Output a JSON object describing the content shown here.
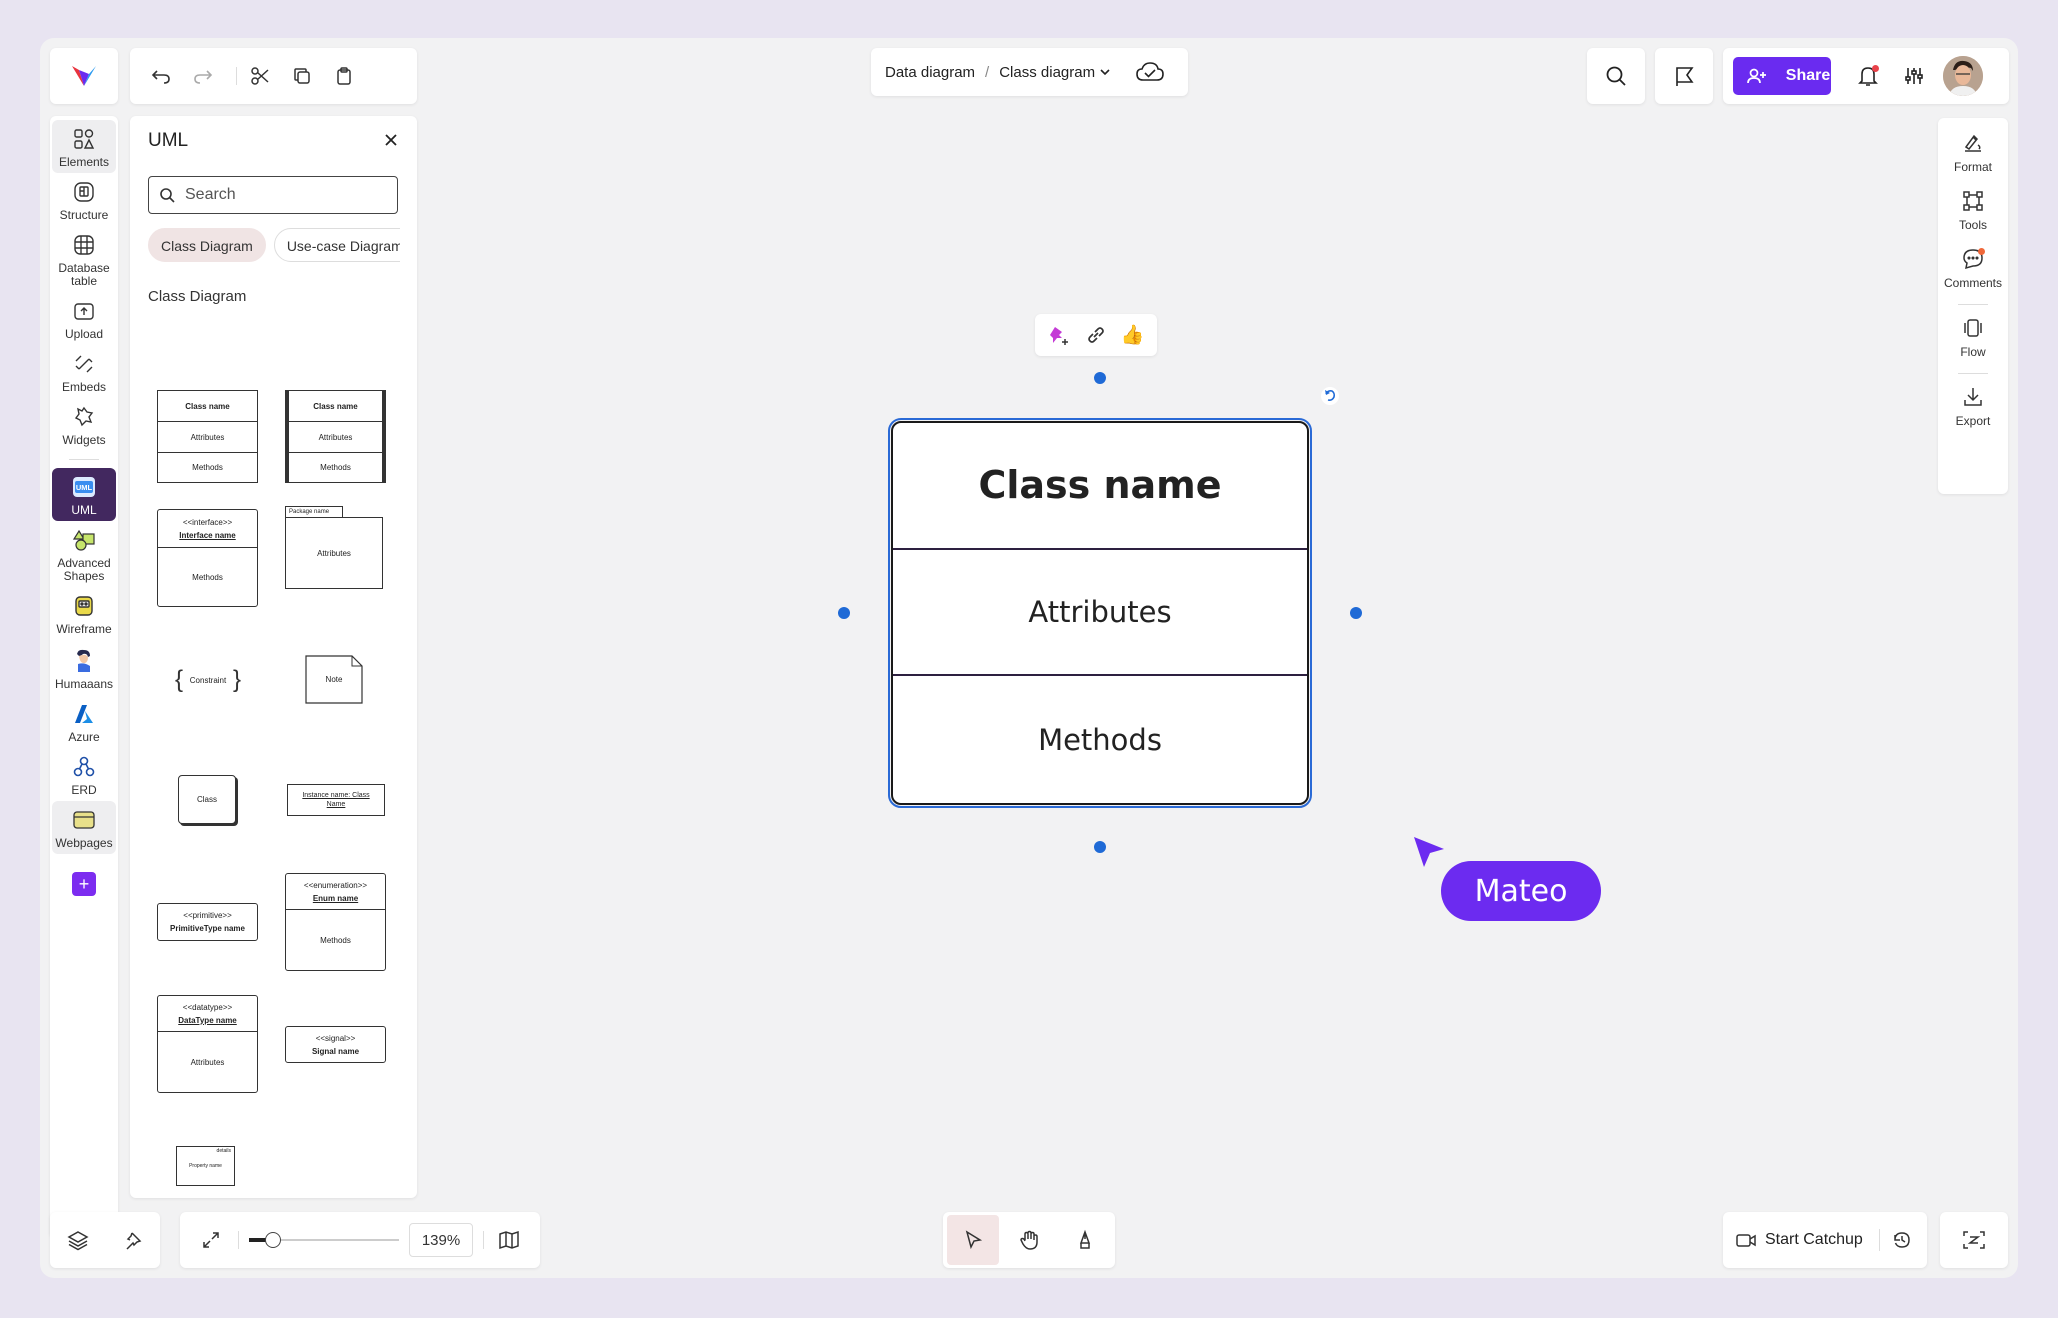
{
  "colors": {
    "accent": "#6a2bf0",
    "selection": "#1f6ad6",
    "active_rail": "#42285f"
  },
  "rail": {
    "items": [
      {
        "label": "Elements",
        "icon": "elements-icon"
      },
      {
        "label": "Structure",
        "icon": "structure-icon"
      },
      {
        "label": "Database table",
        "icon": "database-table-icon"
      },
      {
        "label": "Upload",
        "icon": "upload-icon"
      },
      {
        "label": "Embeds",
        "icon": "embeds-icon"
      },
      {
        "label": "Widgets",
        "icon": "widgets-icon"
      },
      {
        "label": "UML",
        "icon": "uml-icon",
        "active": true
      },
      {
        "label": "Advanced Shapes",
        "icon": "advanced-shapes-icon"
      },
      {
        "label": "Wireframe",
        "icon": "wireframe-icon"
      },
      {
        "label": "Humaaans",
        "icon": "humaaans-icon"
      },
      {
        "label": "Azure",
        "icon": "azure-icon"
      },
      {
        "label": "ERD",
        "icon": "erd-icon"
      },
      {
        "label": "Webpages",
        "icon": "webpages-icon"
      }
    ],
    "uml_icon_text": "UML",
    "add": "+"
  },
  "panel": {
    "title": "UML",
    "search_placeholder": "Search",
    "tabs": [
      "Class Diagram",
      "Use-case Diagram"
    ],
    "section_title": "Class Diagram",
    "shapes": {
      "class1": {
        "name": "Class name",
        "attrs": "Attributes",
        "methods": "Methods"
      },
      "class2": {
        "name": "Class name",
        "attrs": "Attributes",
        "methods": "Methods"
      },
      "interface": {
        "stereo": "<<interface>>",
        "name": "Interface name",
        "methods": "Methods"
      },
      "package": {
        "tab": "Package name",
        "attrs": "Attributes"
      },
      "constraint": "Constraint",
      "note": "Note",
      "class_small": "Class",
      "instance": "Instance name: Class Name",
      "enumeration": {
        "stereo": "<<enumeration>>",
        "name": "Enum name",
        "methods": "Methods"
      },
      "primitive": {
        "stereo": "<<primitive>>",
        "name": "PrimitiveType name"
      },
      "datatype": {
        "stereo": "<<datatype>>",
        "name": "DataType name",
        "attrs": "Attributes"
      },
      "signal": {
        "stereo": "<<signal>>",
        "name": "Signal name"
      },
      "property": {
        "tag": "details",
        "name": "Property name"
      }
    }
  },
  "breadcrumb": {
    "parent": "Data diagram",
    "separator": "/",
    "current": "Class diagram"
  },
  "topbar": {
    "share_label": "Share"
  },
  "right_rail": {
    "items": [
      {
        "label": "Format",
        "icon": "format-icon"
      },
      {
        "label": "Tools",
        "icon": "tools-icon"
      },
      {
        "label": "Comments",
        "icon": "comments-icon"
      },
      {
        "label": "Flow",
        "icon": "flow-icon"
      },
      {
        "label": "Export",
        "icon": "export-icon"
      }
    ]
  },
  "canvas": {
    "quick_actions": {
      "thumbs_emoji": "👍"
    },
    "class_box": {
      "name": "Class name",
      "attributes": "Attributes",
      "methods": "Methods"
    },
    "collaborator": {
      "name": "Mateo",
      "color": "#6c2bf0"
    }
  },
  "bottom": {
    "zoom_level": "139%",
    "zoom_fraction": 0.16,
    "catchup_label": "Start Catchup"
  }
}
